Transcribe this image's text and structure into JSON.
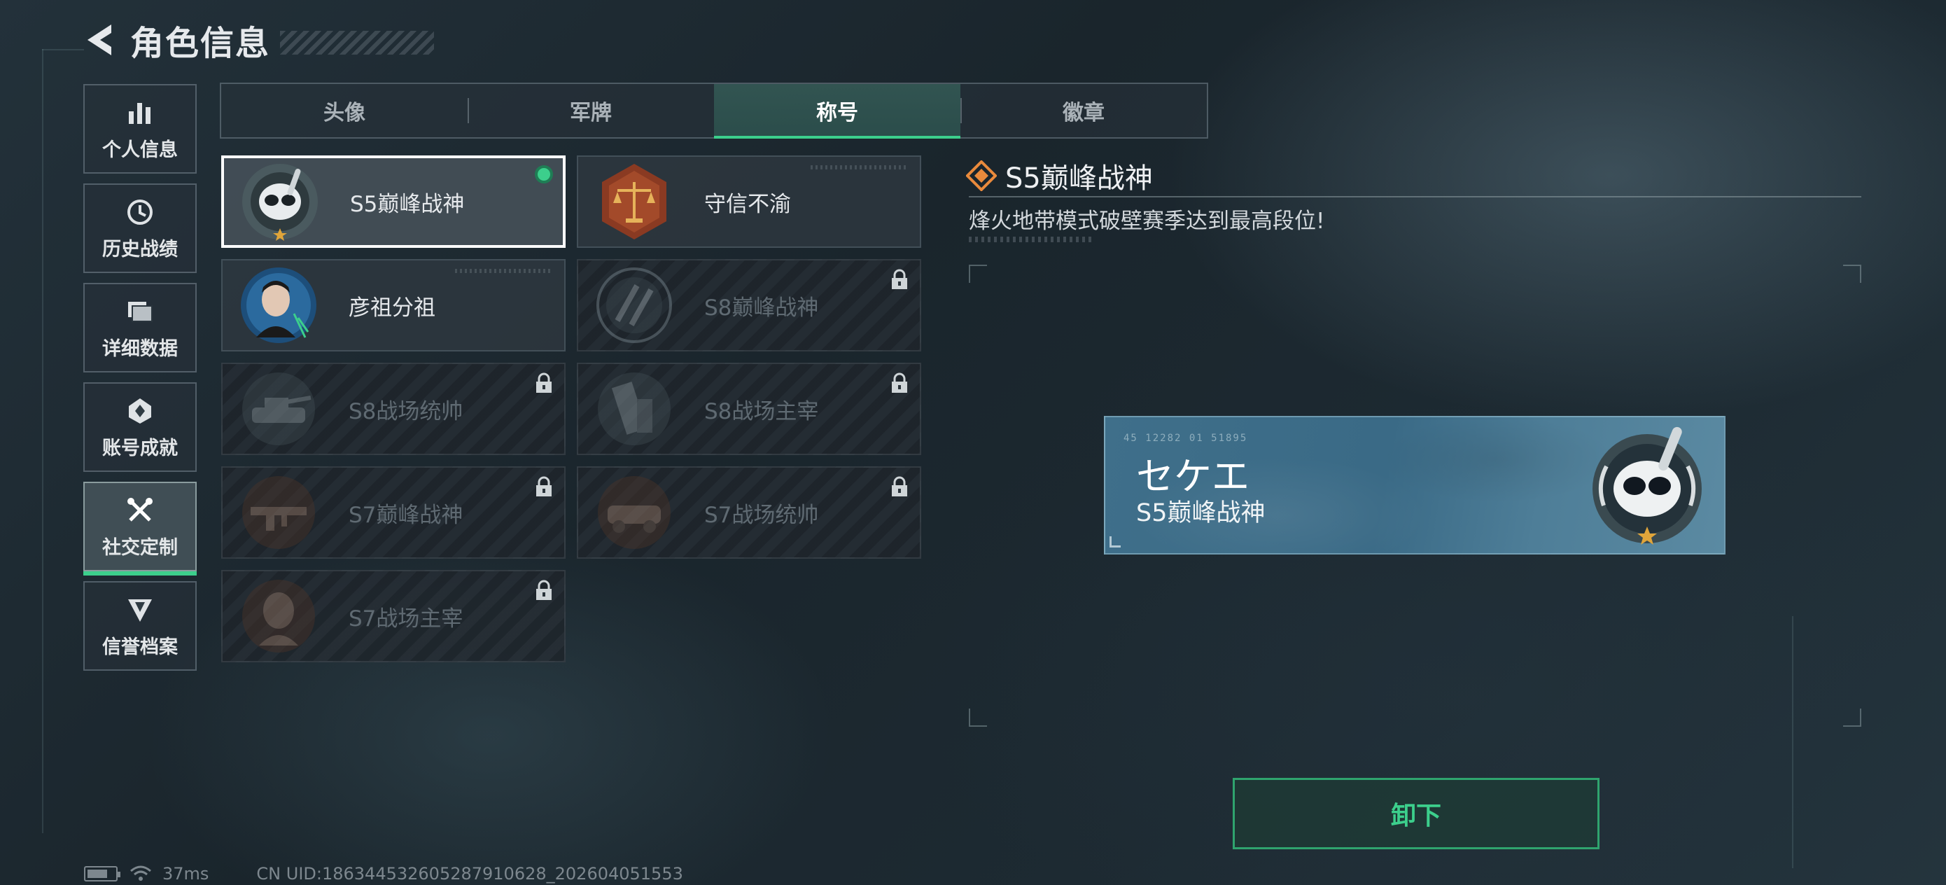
{
  "header": {
    "title": "角色信息"
  },
  "sidebar": {
    "items": [
      {
        "label": "个人信息",
        "icon": "bar-chart-icon",
        "active": false
      },
      {
        "label": "历史战绩",
        "icon": "history-icon",
        "active": false
      },
      {
        "label": "详细数据",
        "icon": "folder-icon",
        "active": false
      },
      {
        "label": "账号成就",
        "icon": "achievement-icon",
        "active": false
      },
      {
        "label": "社交定制",
        "icon": "tools-icon",
        "active": true
      },
      {
        "label": "信誉档案",
        "icon": "credit-shield-icon",
        "active": false
      }
    ]
  },
  "tabs": [
    {
      "label": "头像",
      "active": false
    },
    {
      "label": "军牌",
      "active": false
    },
    {
      "label": "称号",
      "active": true
    },
    {
      "label": "徽章",
      "active": false
    }
  ],
  "titles": [
    {
      "label": "S5巅峰战神",
      "state": "equipped",
      "badge": "diver-skull-badge-icon"
    },
    {
      "label": "守信不渝",
      "state": "unlocked",
      "badge": "scales-badge-icon"
    },
    {
      "label": "彦祖分祖",
      "state": "unlocked",
      "badge": "portrait-badge-icon"
    },
    {
      "label": "S8巅峰战神",
      "state": "locked",
      "badge": "slash-badge-icon"
    },
    {
      "label": "S8战场统帅",
      "state": "locked",
      "badge": "tank-badge-icon"
    },
    {
      "label": "S8战场主宰",
      "state": "locked",
      "badge": "building-badge-icon"
    },
    {
      "label": "S7巅峰战神",
      "state": "locked",
      "badge": "rifle-badge-icon"
    },
    {
      "label": "S7战场统帅",
      "state": "locked",
      "badge": "vehicle-badge-icon"
    },
    {
      "label": "S7战场主宰",
      "state": "locked",
      "badge": "soldier-badge-icon"
    }
  ],
  "detail": {
    "title": "S5巅峰战神",
    "description": "烽火地带模式破壁赛季达到最高段位!"
  },
  "nameplate": {
    "code": "45 12282   01 51895",
    "player_name": "セケエ",
    "title": "S5巅峰战神"
  },
  "actions": {
    "unequip_label": "卸下"
  },
  "footer": {
    "ping": "37ms",
    "uid": "CN UID:1863445326052879​10628_202604051553"
  },
  "colors": {
    "accent": "#3ccf8c",
    "diamond": "#e98a3c"
  }
}
